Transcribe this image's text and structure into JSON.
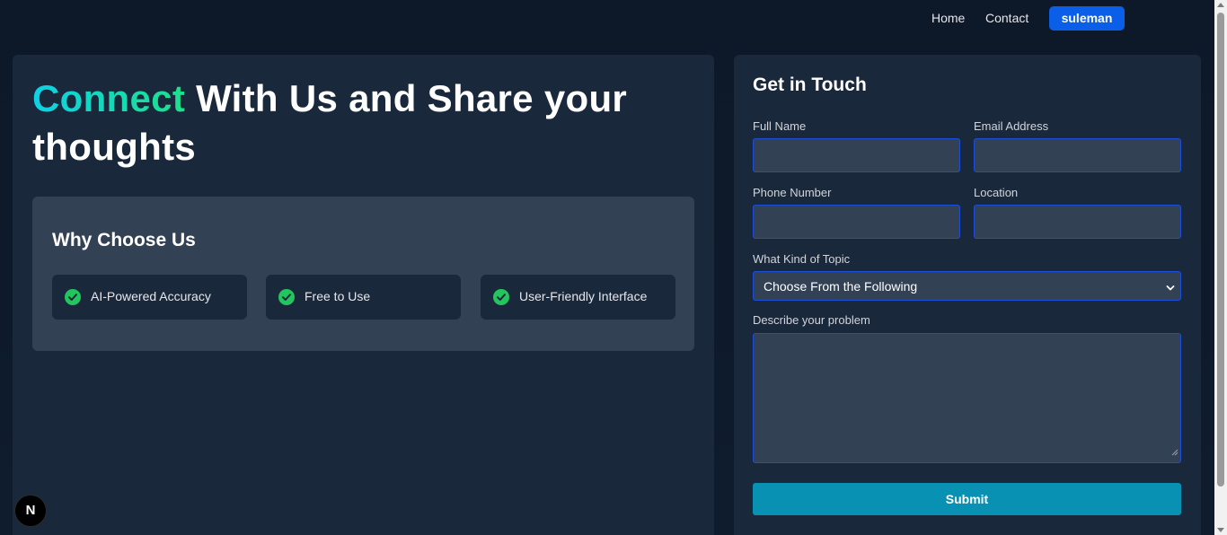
{
  "nav": {
    "links": [
      {
        "label": "Home"
      },
      {
        "label": "Contact"
      }
    ],
    "user_label": "suleman",
    "user_color": "#0b5ee8"
  },
  "hero": {
    "accent_word": "Connect",
    "title_rest": " With Us and Share your thoughts",
    "accent_gradient": [
      "#0fd0e6",
      "#1ee08a"
    ]
  },
  "why": {
    "title": "Why Choose Us",
    "features": [
      {
        "label": "AI-Powered Accuracy",
        "icon": "check-circle-icon"
      },
      {
        "label": "Free to Use",
        "icon": "check-circle-icon"
      },
      {
        "label": "User-Friendly Interface",
        "icon": "check-circle-icon"
      }
    ],
    "check_color": "#22c55e"
  },
  "form": {
    "title": "Get in Touch",
    "full_name": {
      "label": "Full Name",
      "value": "",
      "placeholder": ""
    },
    "email": {
      "label": "Email Address",
      "value": "",
      "placeholder": ""
    },
    "phone": {
      "label": "Phone Number",
      "value": "",
      "placeholder": ""
    },
    "location": {
      "label": "Location",
      "value": "",
      "placeholder": ""
    },
    "topic": {
      "label": "What Kind of Topic",
      "selected": "Choose From the Following"
    },
    "problem": {
      "label": "Describe your problem",
      "value": ""
    },
    "submit_label": "Submit",
    "submit_color": "#0891b2",
    "input_border_color": "#1d4ed8"
  },
  "badge": {
    "label": "N"
  }
}
